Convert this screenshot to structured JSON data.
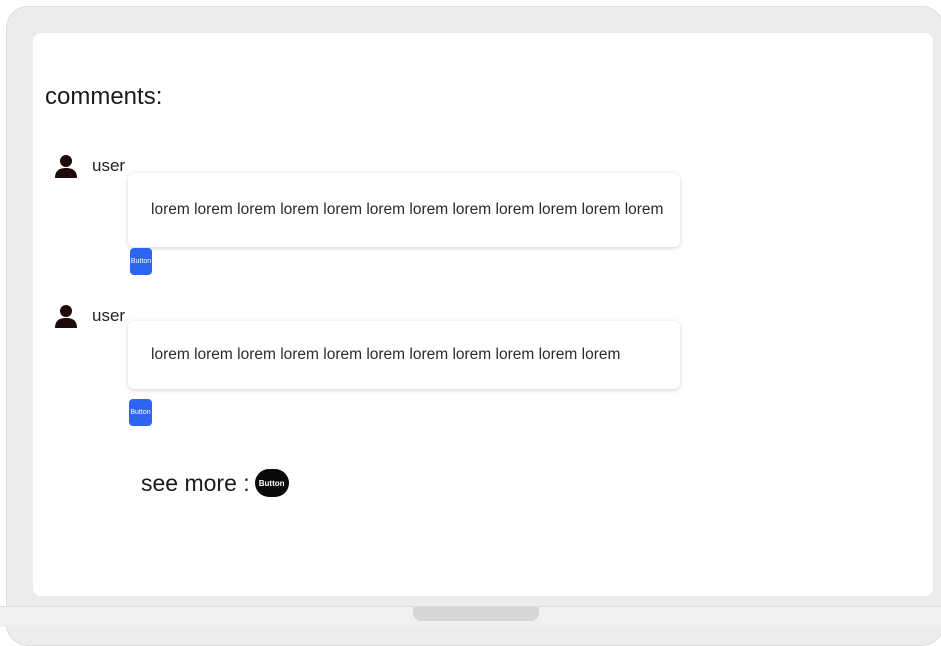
{
  "comments_section": {
    "heading": "comments:",
    "items": [
      {
        "user": "user",
        "text": "lorem lorem lorem lorem lorem lorem lorem lorem lorem lorem lorem lorem",
        "button_label": "Button"
      },
      {
        "user": "user",
        "text": "lorem lorem lorem lorem lorem lorem lorem lorem lorem lorem lorem",
        "button_label": "Button"
      }
    ],
    "see_more_label": "see more :",
    "see_more_button_label": "Button"
  },
  "icons": {
    "user": "user-icon"
  },
  "colors": {
    "reply_button": "#2d64f0",
    "see_more_button": "#0a0a0a",
    "user_icon": "#1e0a0a"
  }
}
